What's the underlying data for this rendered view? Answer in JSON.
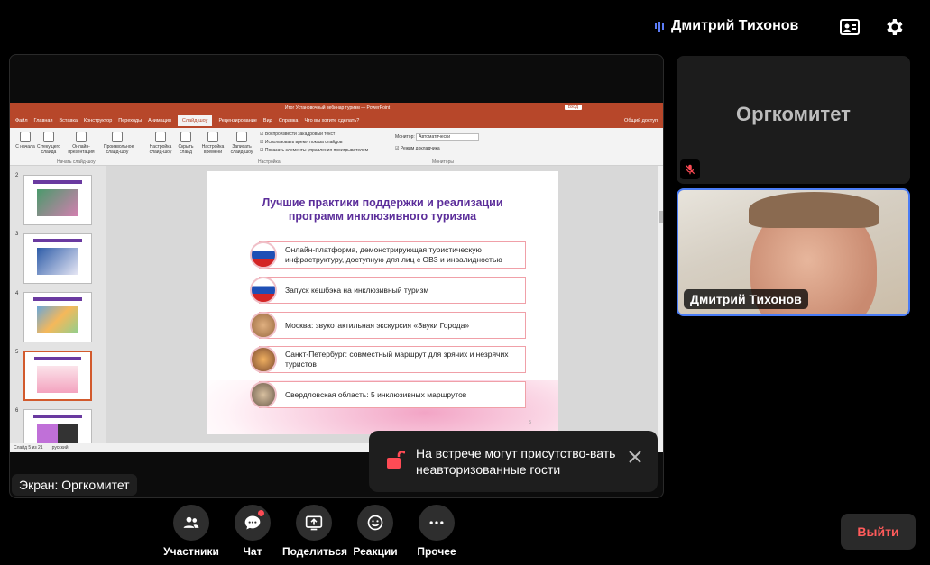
{
  "header": {
    "user_name": "Дмитрий Тихонов"
  },
  "screen_share": {
    "label": "Экран: Оргкомитет",
    "ppt": {
      "window_title": "Итог Установочный вебинар туризм — PowerPoint",
      "view_button": "Вход",
      "tabs": [
        "Файл",
        "Главная",
        "Вставка",
        "Конструктор",
        "Переходы",
        "Анимация",
        "Слайд-шоу",
        "Рецензирование",
        "Вид",
        "Справка",
        "Что вы хотите сделать?"
      ],
      "active_tab": "Слайд-шоу",
      "share_label": "Общий доступ",
      "ribbon_buttons": [
        "С начала",
        "С текущего слайда",
        "Онлайн-презентация",
        "Произвольное слайд-шоу",
        "Настройка слайд-шоу",
        "Скрыть слайд",
        "Настройка времени",
        "Записать слайд-шоу"
      ],
      "ribbon_checks": [
        "Воспроизвести закадровый текст",
        "Использовать время показа слайдов",
        "Показать элементы управления проигрывателем"
      ],
      "monitor_label": "Монитор:",
      "monitor_value": "Автоматически",
      "presenter_mode": "Режим докладчика",
      "group_labels": [
        "Начать слайд-шоу",
        "Настройка",
        "Мониторы"
      ],
      "thumbnail_numbers": [
        "2",
        "3",
        "4",
        "5",
        "6"
      ],
      "selected_thumbnail": "5",
      "status_left": "Слайд 5 из 21",
      "status_lang": "русский",
      "slide": {
        "heading_line1": "Лучшие практики поддержки и реализации",
        "heading_line2": "программ инклюзивного туризма",
        "rows": [
          "Онлайн-платформа, демонстрирующая туристическую инфраструктуру, доступную для лиц с ОВЗ и инвалидностью",
          "Запуск кешбэка на инклюзивный туризм",
          "Москва: звукотактильная экскурсия «Звуки Города»",
          "Санкт-Петербург: совместный маршрут для зрячих и незрячих туристов",
          "Свердловская область: 5 инклюзивных маршрутов"
        ],
        "page_number": "5"
      }
    }
  },
  "participants": {
    "organizer_tile_name": "Оргкомитет",
    "user_tile_name": "Дмитрий Тихонов"
  },
  "toast": {
    "text": "На встрече могут присутство-вать неавторизованные гости"
  },
  "controls": {
    "participants": "Участники",
    "chat": "Чат",
    "share": "Поделиться",
    "reactions": "Реакции",
    "more": "Прочее",
    "leave": "Выйти"
  },
  "colors": {
    "accent_blue": "#4a7cf5",
    "leave_red": "#ff5b5b",
    "ppt_orange": "#b7472a",
    "slide_purple": "#5b2d9a"
  }
}
